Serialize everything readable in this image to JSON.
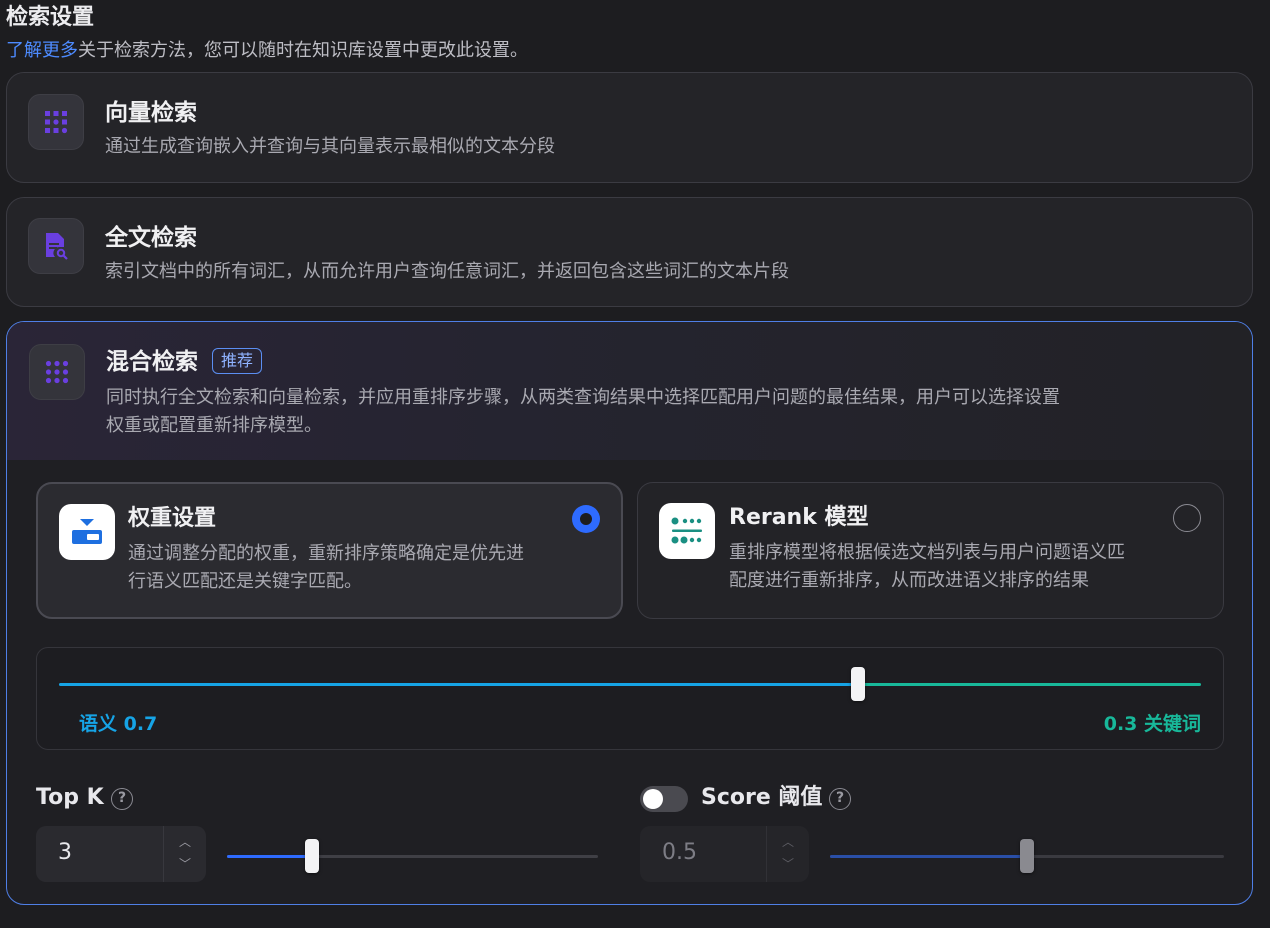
{
  "header": {
    "title": "检索设置",
    "subtitle_link": "了解更多",
    "subtitle_text": "关于检索方法，您可以随时在知识库设置中更改此设置。"
  },
  "methods": {
    "vector": {
      "title": "向量检索",
      "desc": "通过生成查询嵌入并查询与其向量表示最相似的文本分段",
      "icon": "grid-icon"
    },
    "fulltext": {
      "title": "全文检索",
      "desc": "索引文档中的所有词汇，从而允许用户查询任意词汇，并返回包含这些词汇的文本片段",
      "icon": "document-search-icon"
    },
    "hybrid": {
      "title": "混合检索",
      "badge": "推荐",
      "desc_line1": "同时执行全文检索和向量检索，并应用重排序步骤，从两类查询结果中选择匹配用户问题的最佳结果，用户可以选择设置",
      "desc_line2": "权重或配置重新排序模型。",
      "icon": "dots-grid-icon",
      "selected": true
    }
  },
  "rerank_options": {
    "weight": {
      "title": "权重设置",
      "desc_line1": "通过调整分配的权重，重新排序策略确定是优先进",
      "desc_line2": "行语义匹配还是关键字匹配。",
      "selected": true
    },
    "model": {
      "title": "Rerank 模型",
      "desc_line1": "重排序模型将根据候选文档列表与用户问题语义匹",
      "desc_line2": "配度进行重新排序，从而改进语义排序的结果",
      "selected": false
    }
  },
  "weights": {
    "semantic_label": "语义 0.7",
    "keyword_label": "0.3 关键词",
    "semantic": 0.7,
    "keyword": 0.3
  },
  "top_k": {
    "label": "Top K",
    "value": "3",
    "slider": 0.23
  },
  "score": {
    "label": "Score 阈值",
    "value": "0.5",
    "enabled": false,
    "slider": 0.5
  },
  "colors": {
    "accent": "#2e6bff",
    "semantic": "#16a4e6",
    "keyword": "#18b89a",
    "icon_purple": "#6a3fe0"
  }
}
